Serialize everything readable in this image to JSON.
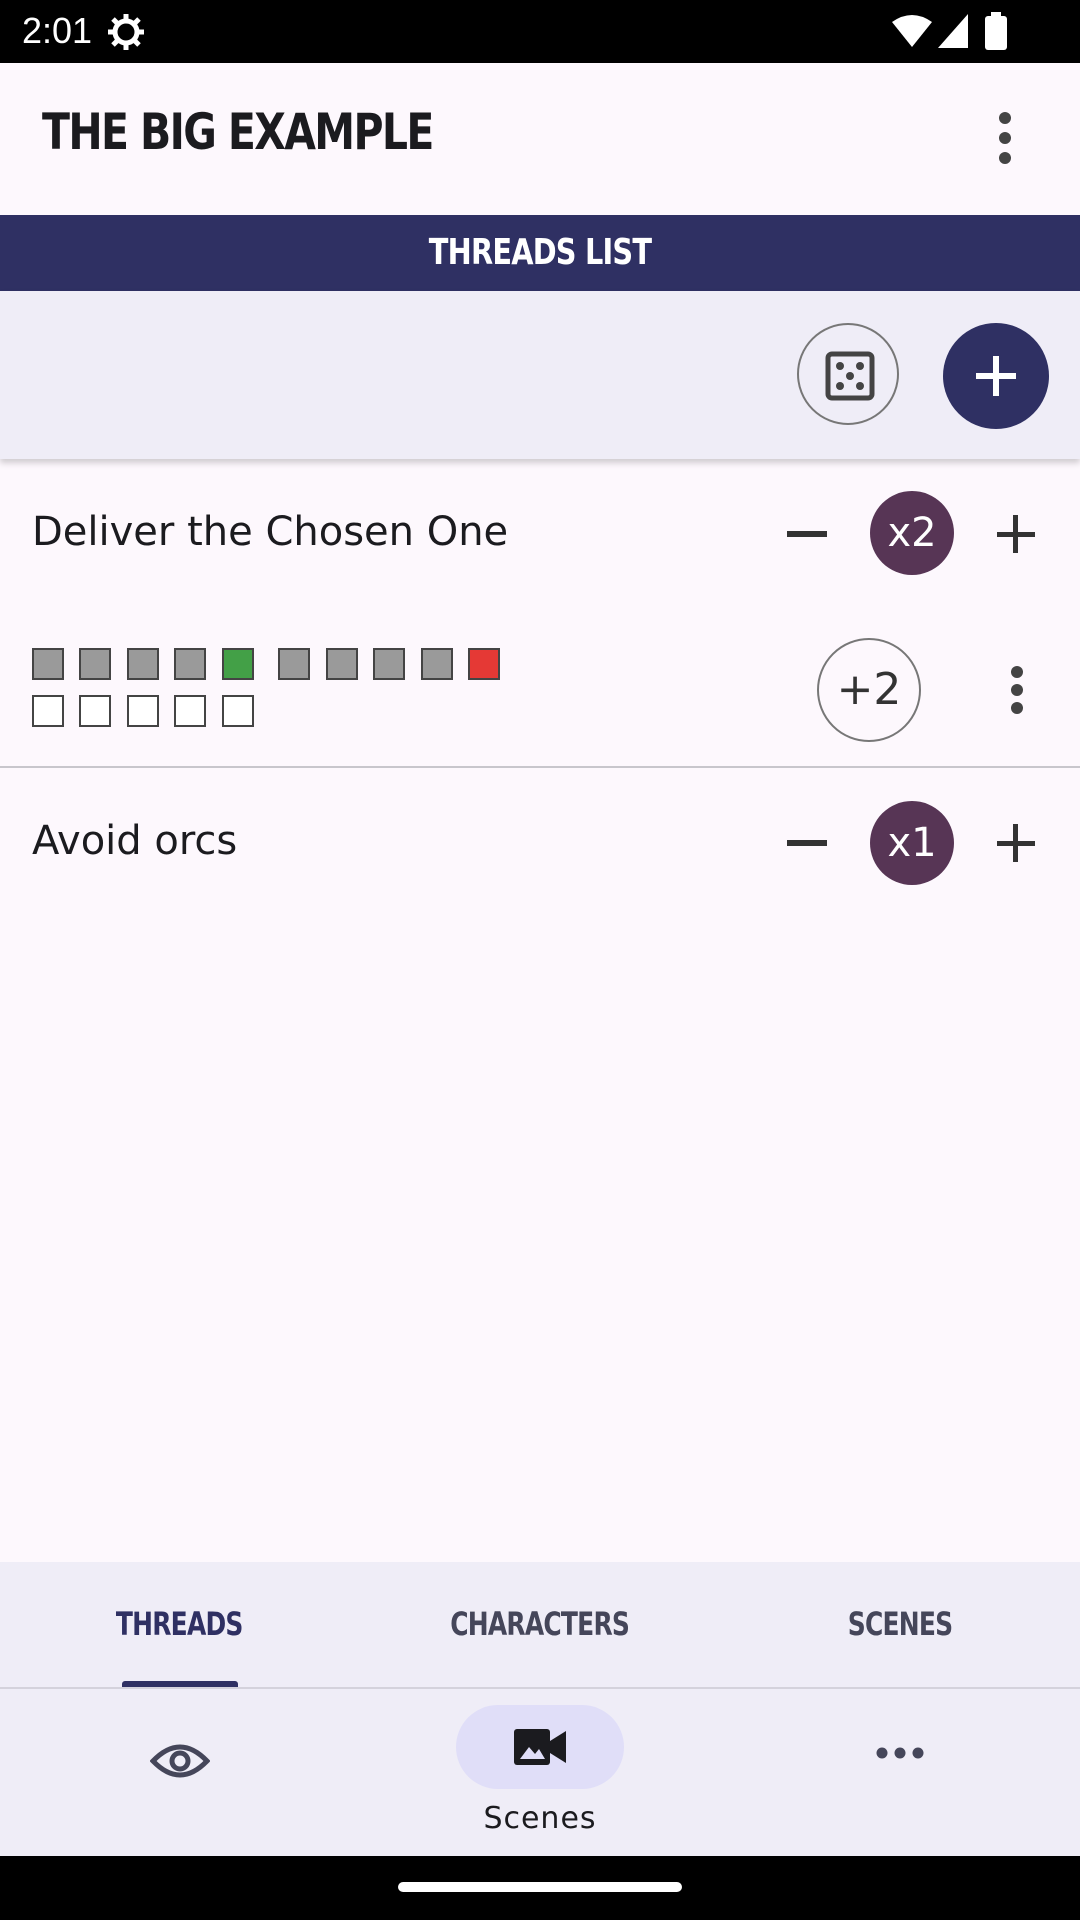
{
  "status_bar": {
    "time": "2:01"
  },
  "app_bar": {
    "title": "THE BIG EXAMPLE"
  },
  "section_header": {
    "title": "THREADS LIST"
  },
  "threads": [
    {
      "title": "Deliver the Chosen One",
      "multiplier": "x2",
      "progress_button": "+2",
      "progress_boxes": {
        "row1": [
          "grey",
          "grey",
          "grey",
          "grey",
          "green",
          "grey",
          "grey",
          "grey",
          "grey",
          "red"
        ],
        "row2": [
          "empty",
          "empty",
          "empty",
          "empty",
          "empty"
        ]
      }
    },
    {
      "title": "Avoid orcs",
      "multiplier": "x1"
    }
  ],
  "tabs": {
    "threads": "THREADS",
    "characters": "CHARACTERS",
    "scenes": "SCENES",
    "active": "threads"
  },
  "bottom_nav": {
    "scenes_label": "Scenes"
  },
  "colors": {
    "primary": "#2f3063",
    "badge": "#573555",
    "surface": "#efedf7",
    "green": "#43a047",
    "red": "#e53935"
  }
}
